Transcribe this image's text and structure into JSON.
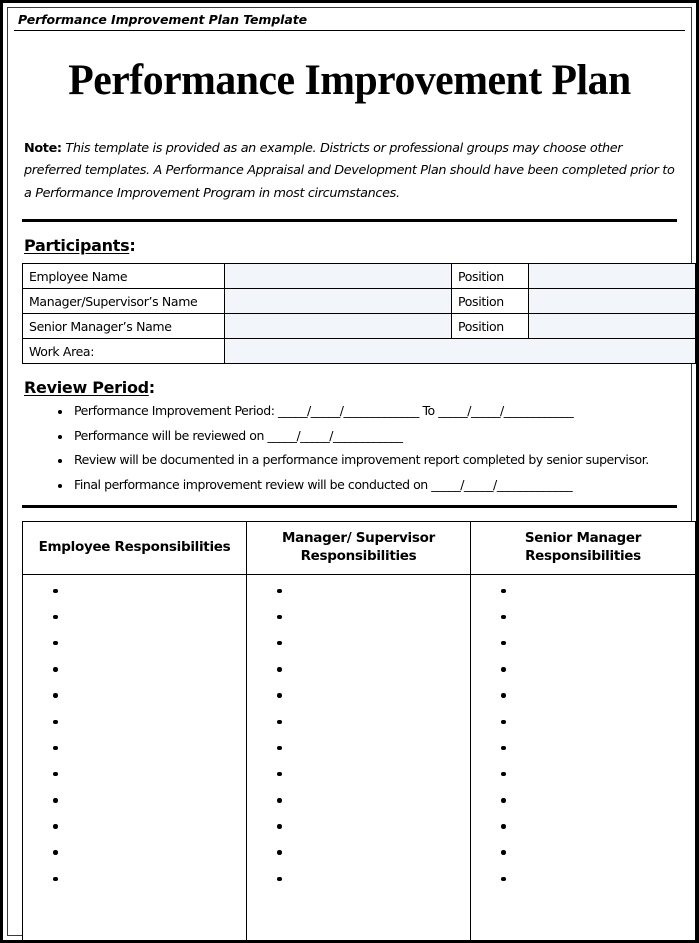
{
  "header": {
    "label": "Performance Improvement Plan Template"
  },
  "title": "Performance Improvement Plan",
  "note": {
    "label": "Note:",
    "text": " This template is provided as an example. Districts or professional groups may choose other preferred templates. A Performance Appraisal and Development Plan should have been completed prior to a Performance Improvement Program in most circumstances."
  },
  "participants": {
    "heading": "Participants",
    "heading_colon": ":",
    "rows": [
      {
        "label": "Employee Name",
        "value": "",
        "position_label": "Position",
        "position_value": ""
      },
      {
        "label": "Manager/Supervisor’s Name",
        "value": "",
        "position_label": "Position",
        "position_value": ""
      },
      {
        "label": "Senior Manager’s Name",
        "value": "",
        "position_label": "Position",
        "position_value": ""
      },
      {
        "label": "Work Area:",
        "value": "",
        "position_label": "",
        "position_value": ""
      }
    ]
  },
  "review_period": {
    "heading": "Review Period",
    "heading_colon": ":",
    "bullets": [
      "Performance Improvement Period: _____/_____/_____________ To _____/_____/____________",
      "Performance will be reviewed on _____/_____/____________",
      "Review will be documented in a performance improvement report completed by senior supervisor.",
      "Final performance improvement review will be conducted on _____/_____/_____________"
    ]
  },
  "responsibilities": {
    "columns": [
      {
        "header": "Employee Responsibilities",
        "bullet_count": 12
      },
      {
        "header": "Manager/ Supervisor Responsibilities",
        "bullet_count": 12
      },
      {
        "header": "Senior Manager Responsibilities",
        "bullet_count": 12
      }
    ]
  },
  "colors": {
    "page_border": "#000000",
    "cell_fill": "#f2f6fa",
    "text": "#000000"
  }
}
